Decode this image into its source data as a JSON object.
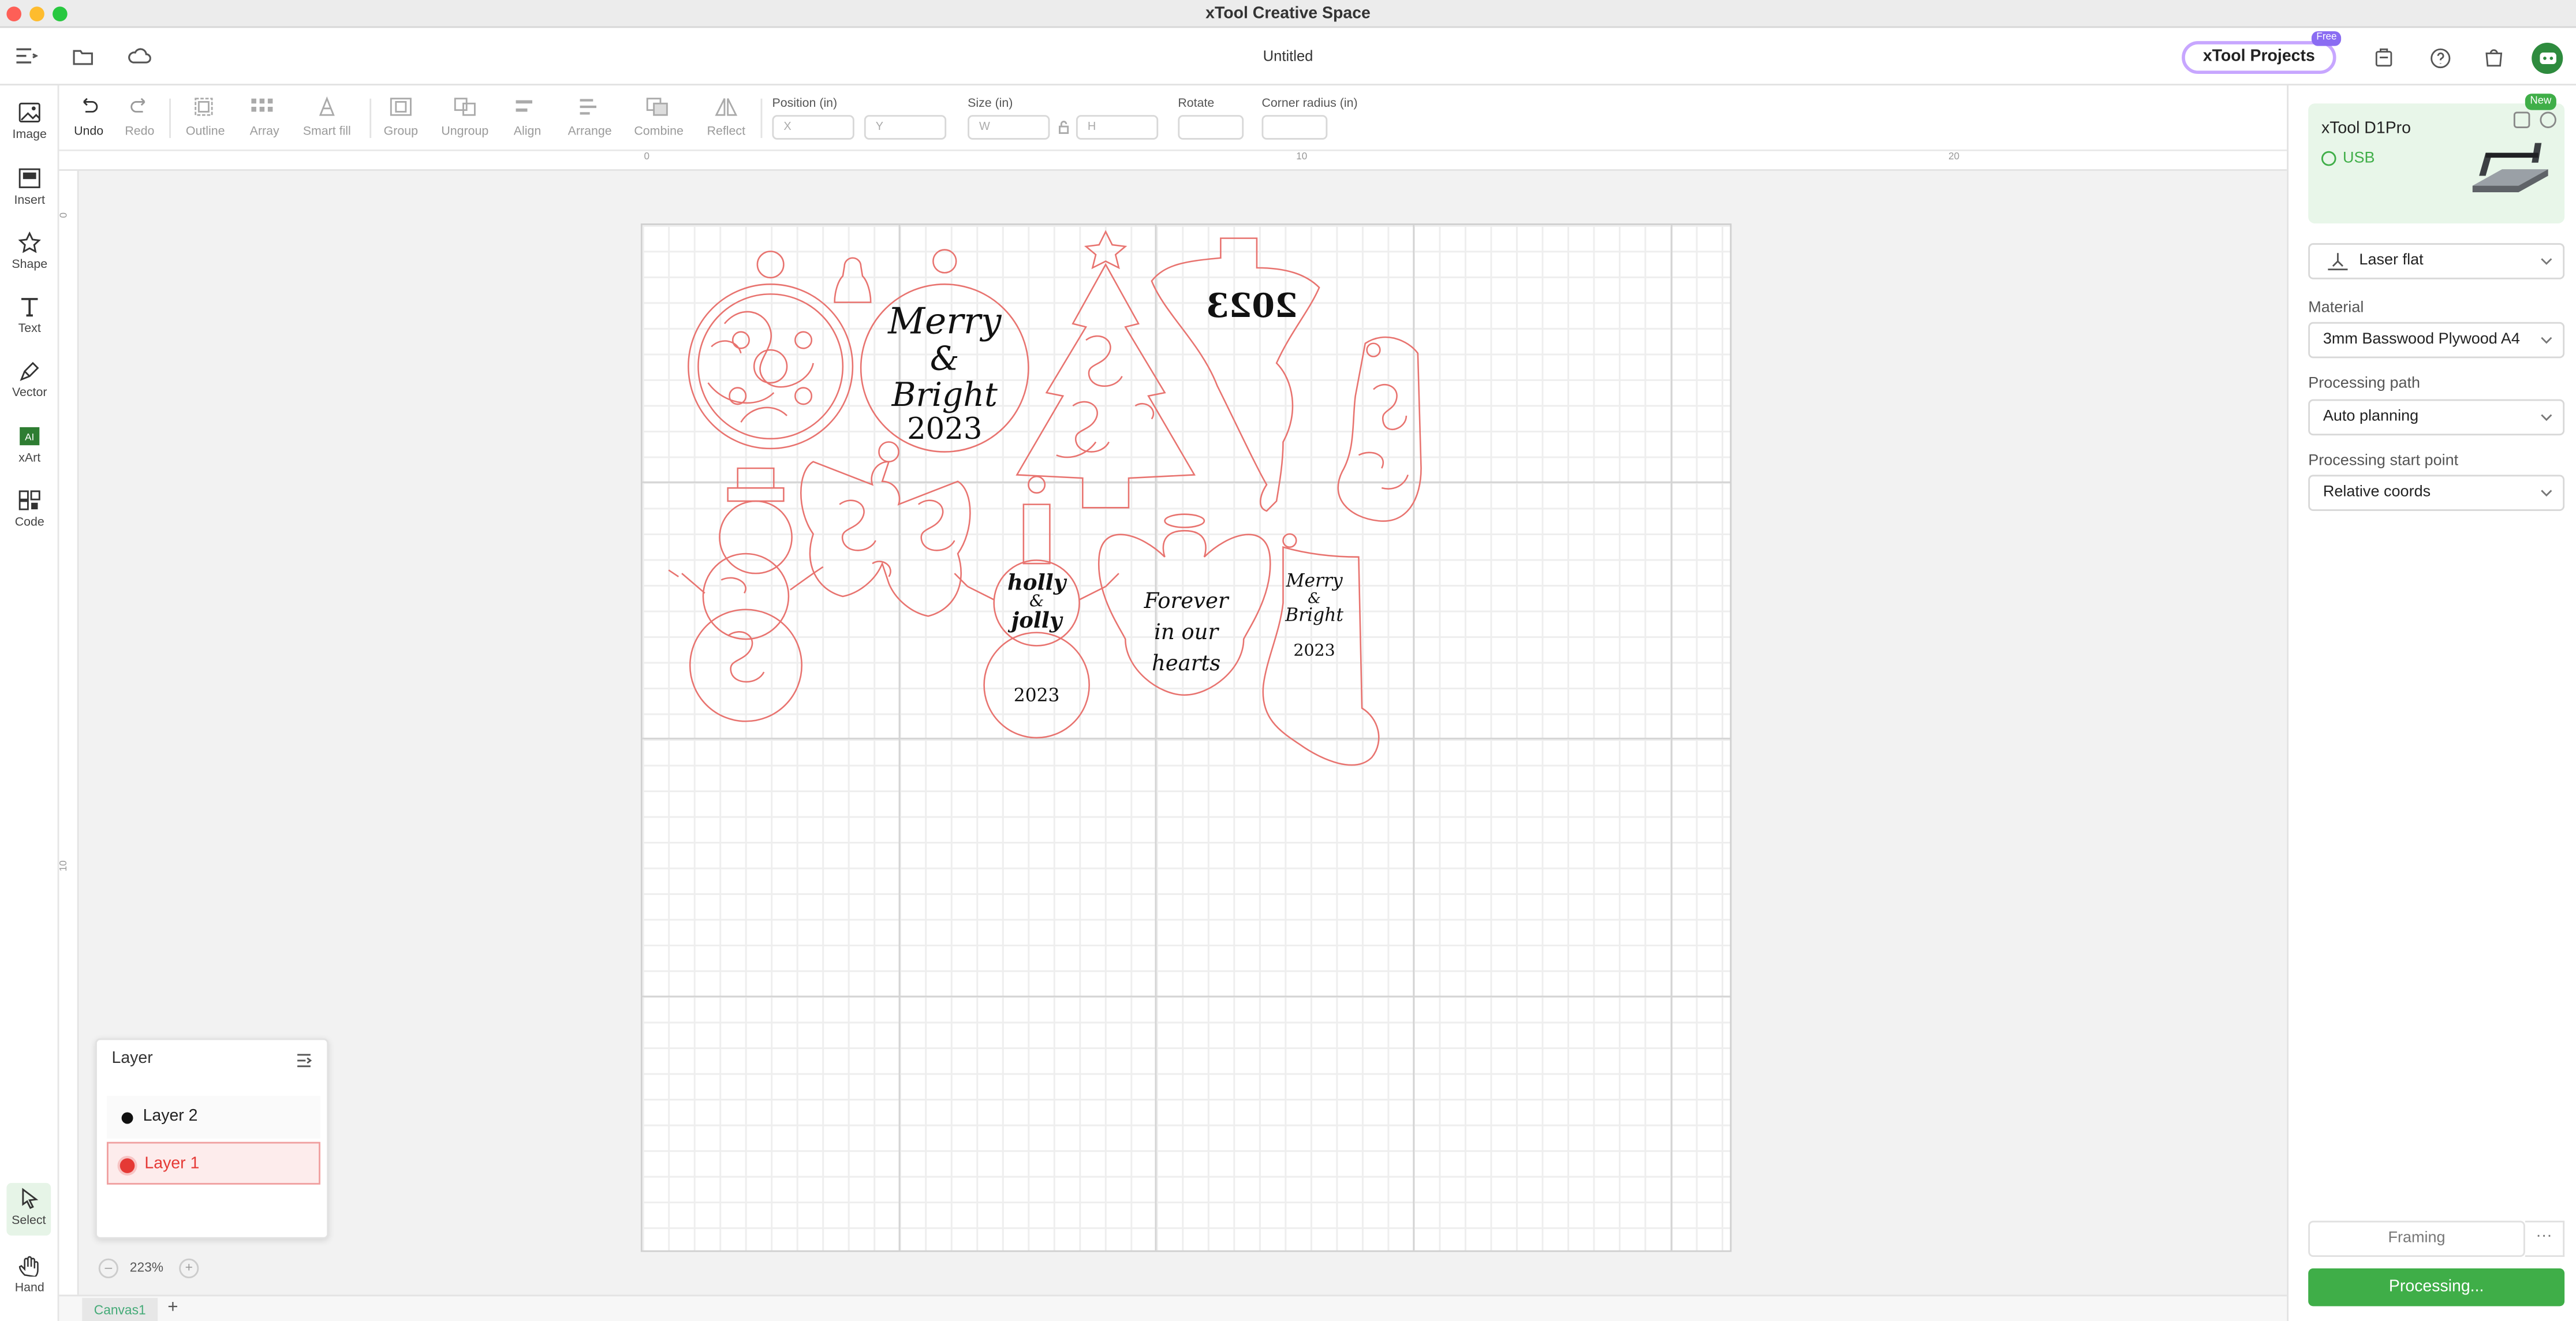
{
  "window": {
    "title": "xTool Creative Space",
    "document": "Untitled"
  },
  "header": {
    "projects_label": "xTool Projects",
    "free_badge": "Free"
  },
  "left_tools": [
    {
      "label": "Image",
      "icon": "image-icon"
    },
    {
      "label": "Insert",
      "icon": "insert-icon"
    },
    {
      "label": "Shape",
      "icon": "star-shape-icon"
    },
    {
      "label": "Text",
      "icon": "text-icon"
    },
    {
      "label": "Vector",
      "icon": "pen-icon"
    },
    {
      "label": "xArt",
      "icon": "ai-art-icon"
    },
    {
      "label": "Code",
      "icon": "qr-code-icon"
    }
  ],
  "bottom_tools": [
    {
      "label": "Select",
      "icon": "cursor-icon"
    },
    {
      "label": "Hand",
      "icon": "hand-icon"
    }
  ],
  "toolbar": {
    "undo": "Undo",
    "redo": "Redo",
    "outline": "Outline",
    "array": "Array",
    "smart_fill": "Smart fill",
    "group": "Group",
    "ungroup": "Ungroup",
    "align": "Align",
    "arrange": "Arrange",
    "combine": "Combine",
    "reflect": "Reflect",
    "position_label": "Position (in)",
    "x_placeholder": "X",
    "y_placeholder": "Y",
    "size_label": "Size (in)",
    "w_placeholder": "W",
    "h_placeholder": "H",
    "rotate_label": "Rotate",
    "corner_label": "Corner radius (in)"
  },
  "ruler": {
    "h_ticks": [
      "0",
      "10",
      "20"
    ],
    "v_ticks": [
      "0",
      "10"
    ]
  },
  "design": {
    "texts": {
      "merry": "Merry",
      "amp": "&",
      "bright": "Bright",
      "year": "2023",
      "year_mirrored": "2023",
      "holly": "holly",
      "jolly": "jolly",
      "forever": "Forever",
      "in_our": "in our",
      "hearts": "hearts"
    },
    "cut_color": "#e8736f"
  },
  "layers": {
    "title": "Layer",
    "items": [
      {
        "name": "Layer 2",
        "color": "#111111"
      },
      {
        "name": "Layer 1",
        "color": "#e53935",
        "selected": true
      }
    ]
  },
  "zoom": {
    "value": "223%",
    "minus": "–",
    "plus": "+"
  },
  "canvas_tab": {
    "label": "Canvas1",
    "add": "+"
  },
  "right_panel": {
    "device": {
      "name": "xTool D1Pro",
      "connection": "USB",
      "new_badge": "New"
    },
    "mode": "Laser flat",
    "material_label": "Material",
    "material": "3mm Basswood Plywood A4",
    "path_label": "Processing path",
    "path": "Auto planning",
    "start_label": "Processing start point",
    "start": "Relative coords",
    "framing": "Framing",
    "more": "···",
    "process": "Processing..."
  },
  "colors": {
    "accent": "#3fae48",
    "cut": "#e8736f",
    "brand_gradient": "#c7a6ff"
  }
}
